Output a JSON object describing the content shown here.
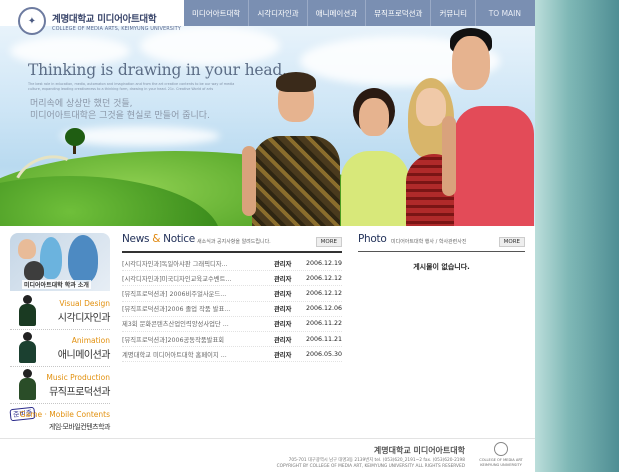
{
  "header": {
    "logo_ko": "계명대학교 미디어아트대학",
    "logo_en": "COLLEGE OF MEDIA ARTS, KEIMYUNG UNIVERSITY"
  },
  "nav": {
    "items": [
      "미디어아트대학",
      "시각디자인과",
      "애니메이션과",
      "뮤직프로덕션과",
      "커뮤니티"
    ],
    "to_main": "TO MAIN"
  },
  "hero": {
    "title": "Thinking is drawing in your head.",
    "fine_print": "The best role in education, media, automaton and imagination and from the art creative contents to be our way of media culture, expanding leading creativeness to a thinking form, drawing in your head. 21c. Creative World of arts",
    "subtitle_line1": "머리속에 상상만 했던 것들,",
    "subtitle_line2": "미디어아트대학은 그것을 현실로 만들어 줍니다."
  },
  "left_col": {
    "banner_caption": "미디어아트대학 학과 소개",
    "departments": [
      {
        "en": "Visual Design",
        "ko": "시각디자인과"
      },
      {
        "en": "Animation",
        "ko": "애니메이션과"
      },
      {
        "en": "Music Production",
        "ko": "뮤직프로덕션과"
      },
      {
        "en": "Game · Mobile Contents",
        "ko": "게임·모바일컨텐츠학과",
        "stamp": "준비중"
      }
    ]
  },
  "news": {
    "title_a": "News ",
    "title_amp": "&",
    "title_b": " Notice",
    "subtitle": "새소식과 공지사항을 알려드립니다.",
    "more": "MORE",
    "rows": [
      {
        "title": "[시각디자인과]독일아샤판 그래픽디자...",
        "author": "관리자",
        "date": "2006.12.19"
      },
      {
        "title": "[시각디자인과]미국디자인교육교수벤트...",
        "author": "관리자",
        "date": "2006.12.12"
      },
      {
        "title": "[뮤직프로덕션과] 2006비주얼사운드...",
        "author": "관리자",
        "date": "2006.12.12"
      },
      {
        "title": "[뮤직프로덕션과]2006 졸업 작품 발표...",
        "author": "관리자",
        "date": "2006.12.06"
      },
      {
        "title": "제3회 문화콘텐츠산업인력양성사업단 ...",
        "author": "관리자",
        "date": "2006.11.22"
      },
      {
        "title": "[뮤직프로덕션과]2006공동작품발표회",
        "author": "관리자",
        "date": "2006.11.21"
      },
      {
        "title": "계명대학교 미디어아트대학 홈페이지 ...",
        "author": "관리자",
        "date": "2006.05.30"
      }
    ]
  },
  "photo": {
    "title": "Photo",
    "subtitle": "미디어아트대학 행사 / 학사관련사진",
    "more": "MORE",
    "empty": "게시물이 없습니다."
  },
  "footer": {
    "title": "계명대학교 미디어아트대학",
    "address": "705-701 대구광역시 남구 대명3동 2139번지 tel. (053)620_2191~2  fax. (053)620-2198",
    "copyright": "COPYRIGHT BY COLLEGE OF MEDIA ART, KEIMYUNG UNIVERSITY  ALL RIGHTS RESERVED",
    "logo_text_1": "COLLEGE OF MEDIA ART",
    "logo_text_2": "KEIMYUNG UNIVERSITY"
  },
  "colors": {
    "nav_bg": "#7a8fb2",
    "accent_orange": "#e2900e",
    "side_teal": "#4f8e94"
  }
}
